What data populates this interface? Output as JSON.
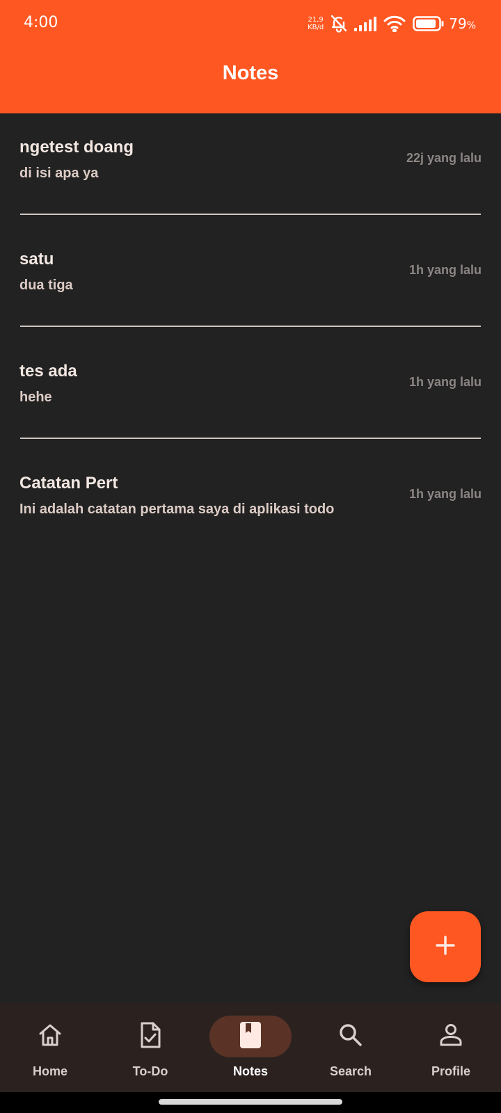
{
  "status_bar": {
    "time": "4:00",
    "net_speed_value": "21,9",
    "net_speed_unit": "KB/d",
    "battery_percent": "79",
    "battery_unit": "%",
    "icons": [
      "bell-off-icon",
      "signal-icon",
      "wifi-icon",
      "battery-icon"
    ]
  },
  "app_bar": {
    "title": "Notes"
  },
  "notes": [
    {
      "title": "ngetest doang",
      "body": "di isi apa ya",
      "time": "22j yang lalu"
    },
    {
      "title": "satu",
      "body": "dua tiga",
      "time": "1h yang lalu"
    },
    {
      "title": "tes ada",
      "body": "hehe",
      "time": "1h yang lalu"
    },
    {
      "title": "Catatan Pert",
      "body": "Ini adalah catatan pertama saya di aplikasi todo",
      "time": "1h yang lalu"
    }
  ],
  "fab": {
    "icon": "plus-icon"
  },
  "bottom_nav": {
    "active": "Notes",
    "items": [
      {
        "label": "Home",
        "icon": "home-icon"
      },
      {
        "label": "To-Do",
        "icon": "todo-icon"
      },
      {
        "label": "Notes",
        "icon": "notes-icon"
      },
      {
        "label": "Search",
        "icon": "search-icon"
      },
      {
        "label": "Profile",
        "icon": "profile-icon"
      }
    ]
  },
  "colors": {
    "accent": "#ff5722",
    "background": "#222222",
    "nav_background": "#2b2220",
    "nav_active_pill": "#5a3326"
  }
}
